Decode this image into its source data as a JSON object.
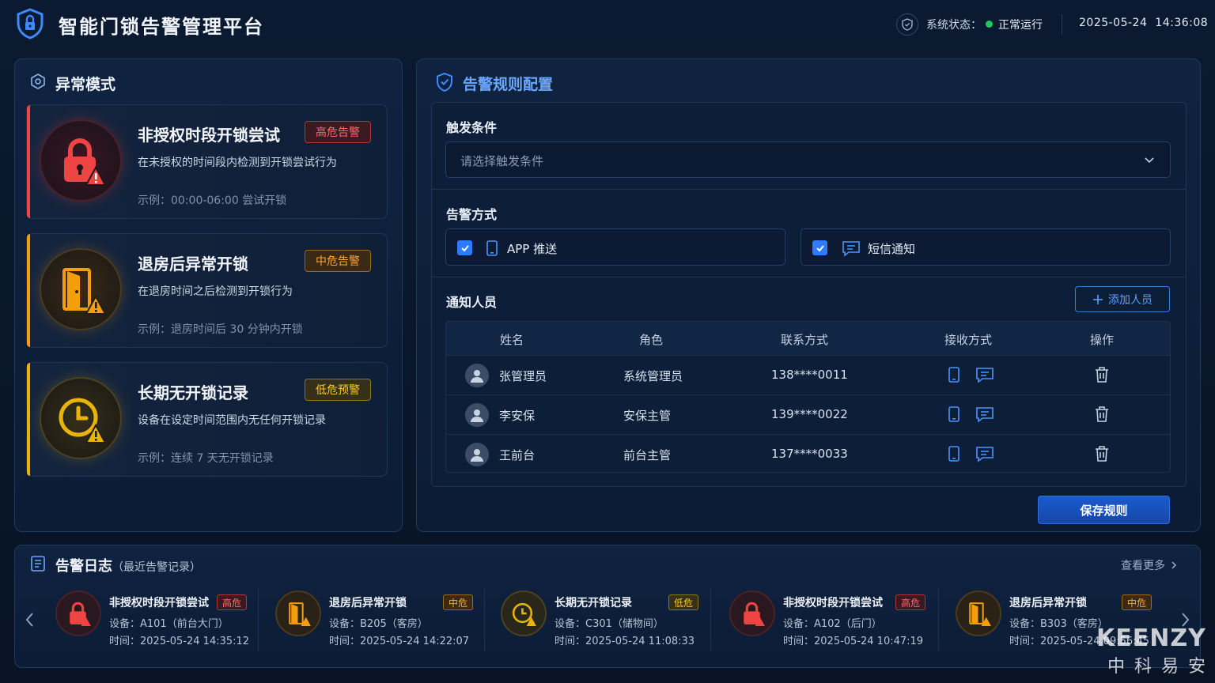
{
  "header": {
    "title": "智能门锁告警管理平台",
    "status_label": "系统状态：",
    "status_value": "正常运行",
    "date": "2025-05-24",
    "time": "14:36:08"
  },
  "anomaly": {
    "title": "异常模式",
    "cards": [
      {
        "title": "非授权时段开锁尝试",
        "badge": "高危告警",
        "desc": "在未授权的时间段内检测到开锁尝试行为",
        "example": "示例：00:00-06:00 尝试开锁",
        "color": "#ef4444",
        "icon": "lock-warning-icon"
      },
      {
        "title": "退房后异常开锁",
        "badge": "中危告警",
        "desc": "在退房时间之后检测到开锁行为",
        "example": "示例：退房时间后 30 分钟内开锁",
        "color": "#f59e0b",
        "icon": "door-warning-icon"
      },
      {
        "title": "长期无开锁记录",
        "badge": "低危预警",
        "desc": "设备在设定时间范围内无任何开锁记录",
        "example": "示例：连续 7 天无开锁记录",
        "color": "#eab308",
        "icon": "clock-warning-icon"
      }
    ]
  },
  "rules": {
    "title": "告警规则配置",
    "trigger_label": "触发条件",
    "trigger_placeholder": "请选择触发条件",
    "method_label": "告警方式",
    "methods": [
      {
        "label": "APP 推送",
        "checked": true
      },
      {
        "label": "短信通知",
        "checked": true
      }
    ],
    "people_label": "通知人员",
    "add_label": "添加人员",
    "columns": [
      "姓名",
      "角色",
      "联系方式",
      "接收方式",
      "操作"
    ],
    "rows": [
      {
        "name": "张管理员",
        "role": "系统管理员",
        "contact": "138****0011"
      },
      {
        "name": "李安保",
        "role": "安保主管",
        "contact": "139****0022"
      },
      {
        "name": "王前台",
        "role": "前台主管",
        "contact": "137****0033"
      }
    ],
    "save_label": "保存规则"
  },
  "log": {
    "title": "告警日志",
    "subtitle": "（最近告警记录）",
    "more": "查看更多",
    "items": [
      {
        "title": "非授权时段开锁尝试",
        "level": "高危",
        "device": "设备：A101（前台大门）",
        "time": "时间：2025-05-24 14:35:12",
        "color": "#ef4444"
      },
      {
        "title": "退房后异常开锁",
        "level": "中危",
        "device": "设备：B205（客房）",
        "time": "时间：2025-05-24 14:22:07",
        "color": "#f59e0b"
      },
      {
        "title": "长期无开锁记录",
        "level": "低危",
        "device": "设备：C301（储物间）",
        "time": "时间：2025-05-24 11:08:33",
        "color": "#eab308"
      },
      {
        "title": "非授权时段开锁尝试",
        "level": "高危",
        "device": "设备：A102（后门）",
        "time": "时间：2025-05-24 10:47:19",
        "color": "#ef4444"
      },
      {
        "title": "退房后异常开锁",
        "level": "中危",
        "device": "设备：B303（客房）",
        "time": "时间：2025-05-24 09:56:45",
        "color": "#f59e0b"
      }
    ]
  },
  "watermark": {
    "brand": "KEENZY",
    "cn": "中科易安"
  }
}
